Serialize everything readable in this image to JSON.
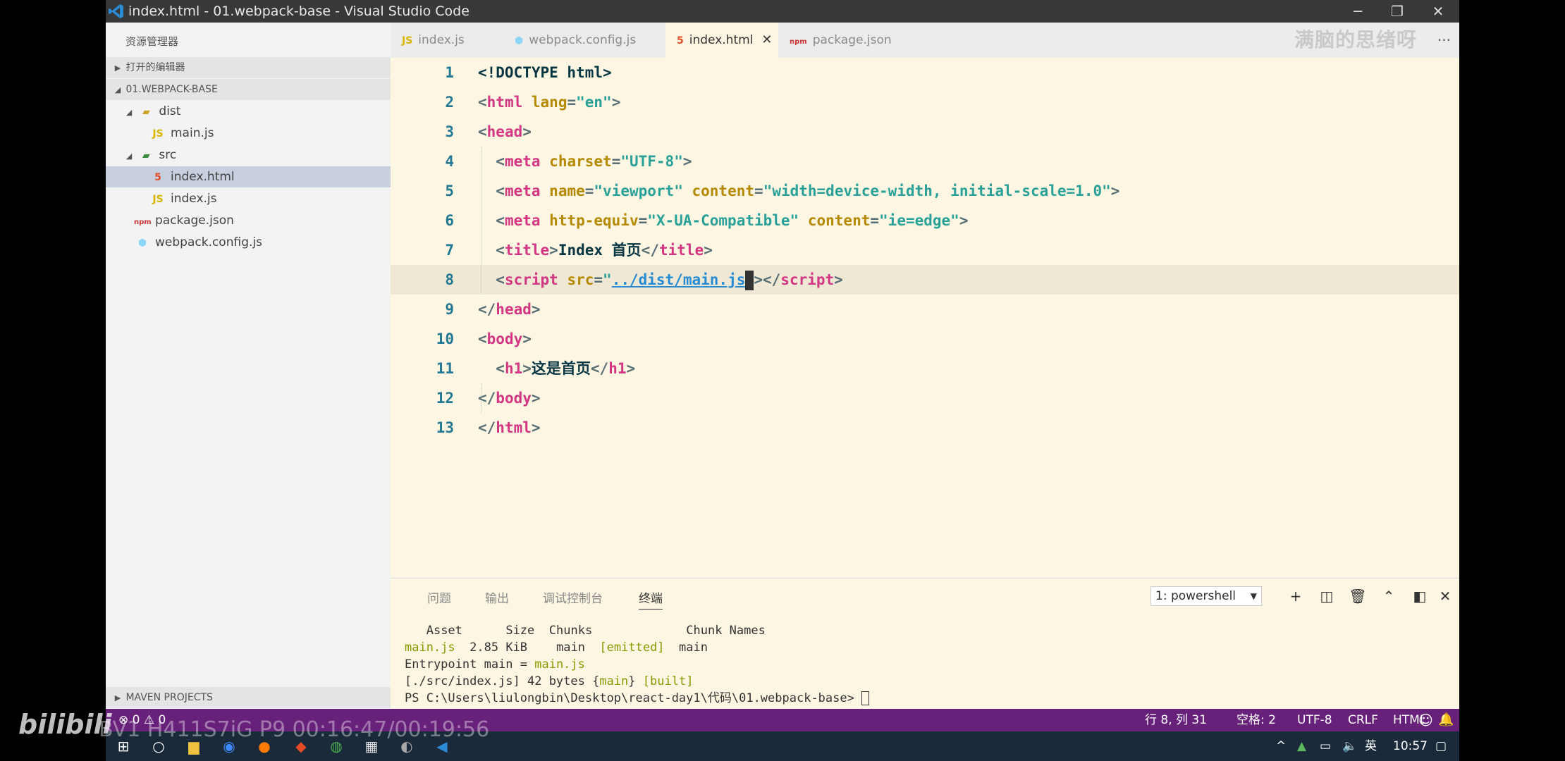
{
  "window": {
    "title": "index.html - 01.webpack-base - Visual Studio Code",
    "min_glyph": "─",
    "restore_glyph": "❐",
    "close_glyph": "✕"
  },
  "sidebar": {
    "header": "资源管理器",
    "open_editors": "打开的编辑器",
    "project": "01.WEBPACK-BASE",
    "tree": [
      {
        "label": "dist"
      },
      {
        "label": "main.js"
      },
      {
        "label": "src"
      },
      {
        "label": "index.html"
      },
      {
        "label": "index.js"
      },
      {
        "label": "package.json"
      },
      {
        "label": "webpack.config.js"
      }
    ],
    "maven": "MAVEN PROJECTS"
  },
  "tabs": [
    {
      "label": "index.js",
      "icon": "JS"
    },
    {
      "label": "webpack.config.js"
    },
    {
      "label": "index.html",
      "close": "✕"
    },
    {
      "label": "package.json"
    }
  ],
  "watermark": "满脑的思绪呀",
  "more_glyph": "···",
  "editor": {
    "line_numbers": [
      "1",
      "2",
      "3",
      "4",
      "5",
      "6",
      "7",
      "8",
      "9",
      "10",
      "11",
      "12",
      "13"
    ],
    "current_line": 8
  },
  "panel": {
    "tabs": [
      "问题",
      "输出",
      "调试控制台",
      "终端"
    ],
    "terminal_select": "1: powershell",
    "terminal": {
      "h_asset": "Asset",
      "h_size": "Size",
      "h_chunks": "Chunks",
      "h_names": "Chunk Names",
      "asset": "main.js",
      "size": "2.85 KiB",
      "chunk": "main",
      "emitted": "[emitted]",
      "name": "main",
      "entry_label": "Entrypoint main = ",
      "entry_value": "main.js",
      "src_pre": "[./src/index.js] 42 bytes {",
      "src_mid": "main",
      "src_mid2": "} ",
      "src_built": "[built]",
      "prompt": "PS C:\\Users\\liulongbin\\Desktop\\react-day1\\代码\\01.webpack-base> "
    }
  },
  "status": {
    "problems": "⊗ 0 ⚠ 0",
    "position": "行 8, 列 31",
    "spaces": "空格: 2",
    "encoding": "UTF-8",
    "eol": "CRLF",
    "language": "HTML"
  },
  "taskbar": {
    "ime": "英",
    "time": "10:57"
  },
  "overlay": {
    "bilibili": "bilibili",
    "video": "BV1 H411S7iG P9 00:16:47/00:19:56"
  },
  "colors": {
    "statusbar": "#68217a",
    "editor_bg": "#fdf6e3",
    "tag": "#d33682",
    "attr": "#b58900",
    "string": "#2aa198"
  }
}
